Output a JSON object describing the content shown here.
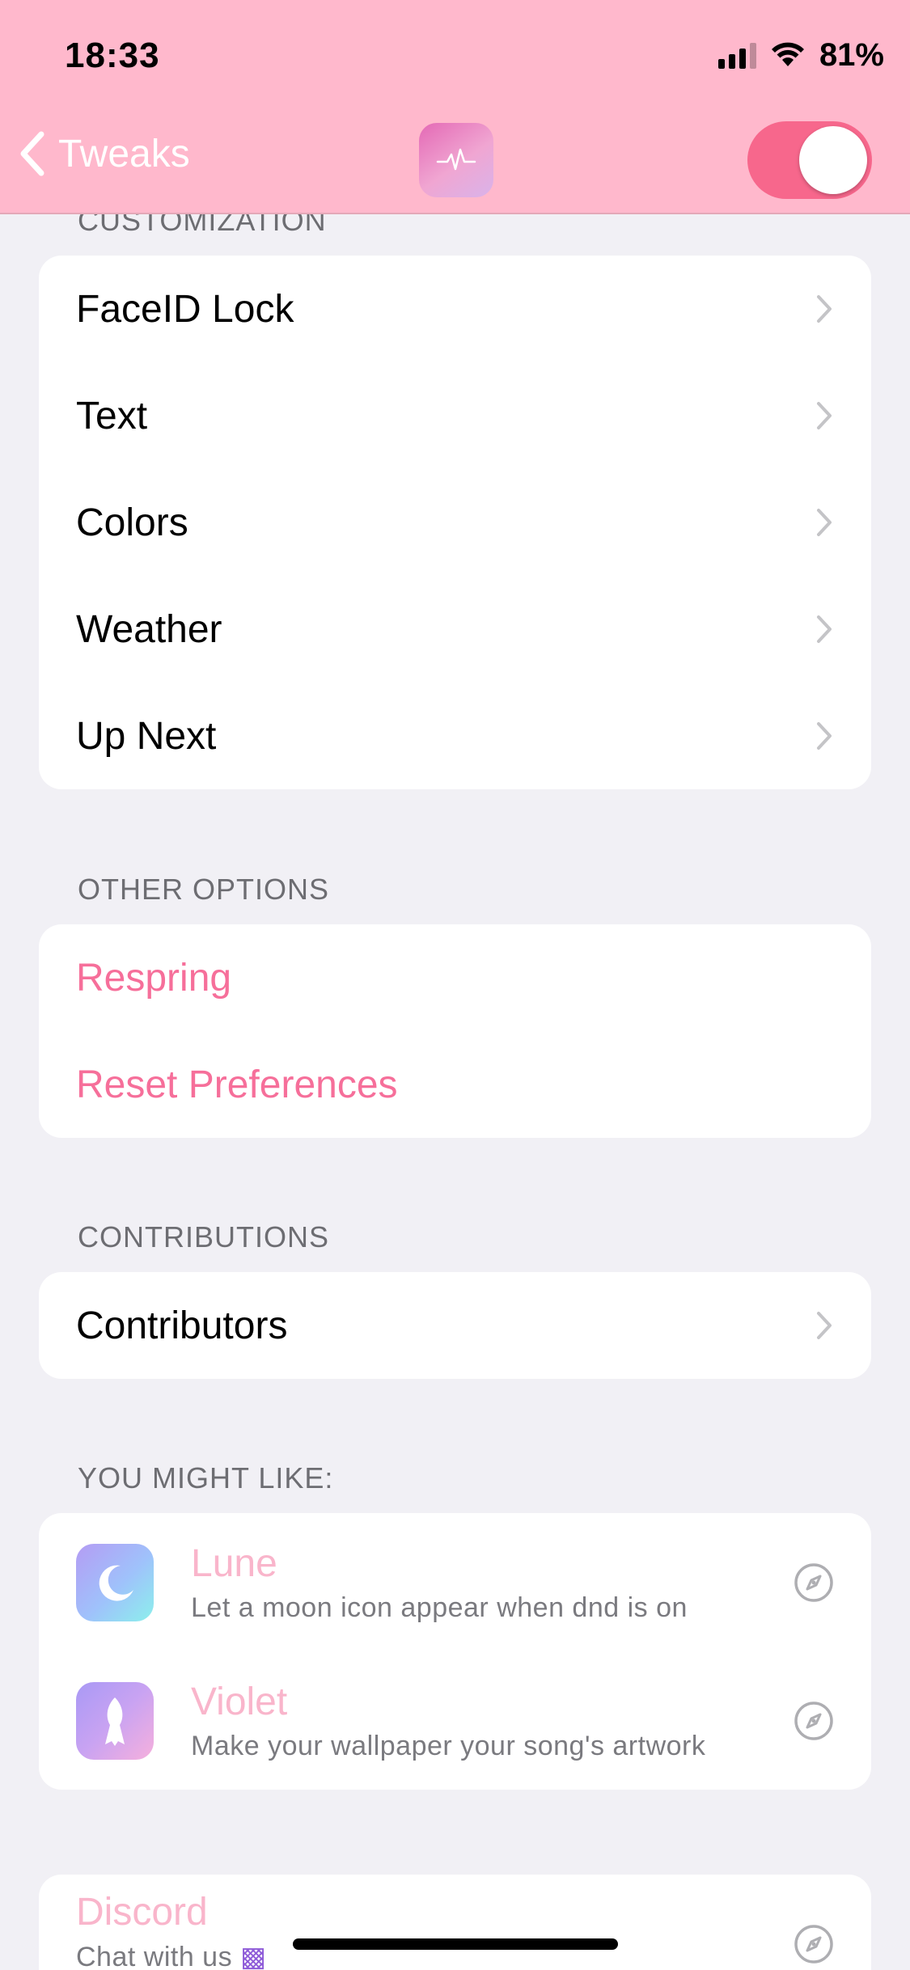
{
  "status_bar": {
    "time": "18:33",
    "battery": "81%"
  },
  "nav": {
    "back_label": "Tweaks",
    "enabled": true
  },
  "sections": {
    "customization": {
      "header": "CUSTOMIZATION",
      "items": [
        {
          "label": "FaceID Lock"
        },
        {
          "label": "Text"
        },
        {
          "label": "Colors"
        },
        {
          "label": "Weather"
        },
        {
          "label": "Up Next"
        }
      ]
    },
    "other_options": {
      "header": "OTHER OPTIONS",
      "items": [
        {
          "label": "Respring"
        },
        {
          "label": "Reset Preferences"
        }
      ]
    },
    "contributions": {
      "header": "CONTRIBUTIONS",
      "items": [
        {
          "label": "Contributors"
        }
      ]
    },
    "you_might_like": {
      "header": "YOU MIGHT LIKE:",
      "items": [
        {
          "name": "Lune",
          "description": "Let a moon icon appear when dnd is on"
        },
        {
          "name": "Violet",
          "description": "Make your wallpaper your song's artwork"
        }
      ]
    },
    "social": {
      "items": [
        {
          "name": "Discord",
          "description": "Chat with us"
        }
      ]
    }
  },
  "colors": {
    "header_bg": "#ffb8cc",
    "accent_pink": "#f66f9a",
    "toggle_on": "#f7678c",
    "link_light_pink": "#f9b5cb"
  }
}
